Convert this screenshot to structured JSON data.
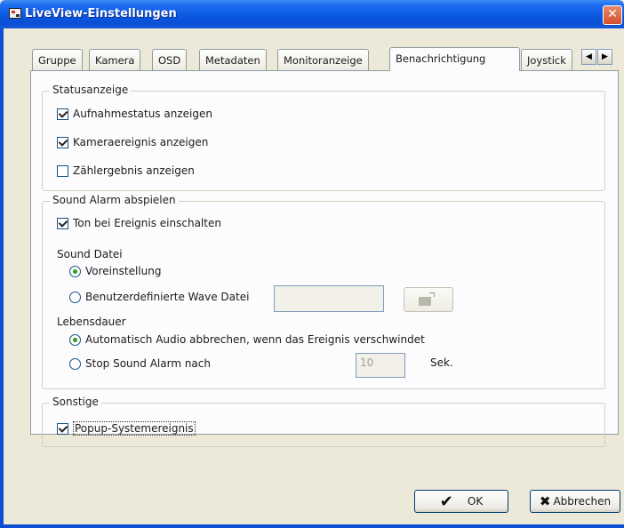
{
  "window": {
    "title": "LiveView-Einstellungen",
    "close_glyph": "✕"
  },
  "tabs": [
    {
      "label": "Gruppe"
    },
    {
      "label": "Kamera"
    },
    {
      "label": "OSD"
    },
    {
      "label": "Metadaten"
    },
    {
      "label": "Monitoranzeige"
    },
    {
      "label": "Benachrichtigung",
      "active": true
    },
    {
      "label": "Joystick"
    }
  ],
  "tab_scroll": {
    "left": "◀",
    "right": "▶"
  },
  "status_group": {
    "legend": "Statusanzeige",
    "items": [
      {
        "label": "Aufnahmestatus anzeigen",
        "checked": true
      },
      {
        "label": "Kameraereignis anzeigen",
        "checked": true
      },
      {
        "label": "Zählergebnis anzeigen",
        "checked": false
      }
    ]
  },
  "sound_group": {
    "legend": "Sound Alarm abspielen",
    "enable_label": "Ton bei Ereignis einschalten",
    "enable_checked": true,
    "sound_file_label": "Sound Datei",
    "default_option": "Voreinstellung",
    "custom_option": "Benutzerdefinierte Wave Datei",
    "custom_value": "",
    "lifetime_label": "Lebensdauer",
    "auto_stop_option": "Automatisch Audio abbrechen, wenn das Ereignis verschwindet",
    "stop_after_option": "Stop Sound Alarm nach",
    "stop_after_value": "10",
    "stop_after_unit": "Sek."
  },
  "other_group": {
    "legend": "Sonstige",
    "popup_label": "Popup-Systemereignis",
    "popup_checked": true
  },
  "buttons": {
    "ok": "OK",
    "ok_glyph": "✔",
    "cancel": "Abbrechen",
    "cancel_glyph": "✖"
  }
}
